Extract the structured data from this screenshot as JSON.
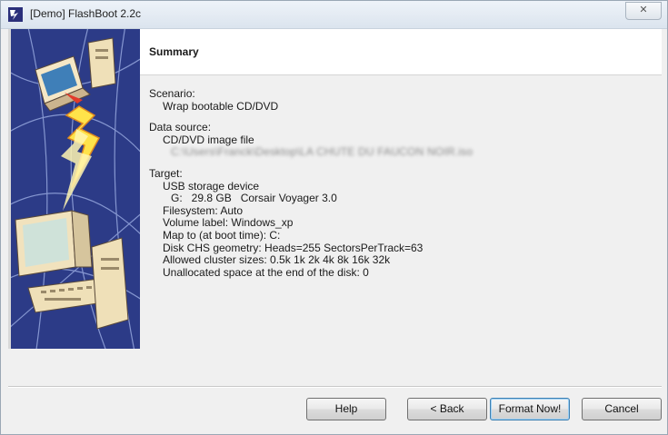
{
  "window": {
    "title": "[Demo] FlashBoot 2.2c",
    "close_glyph": "✕"
  },
  "header": {
    "title": "Summary"
  },
  "summary": {
    "scenario_label": "Scenario:",
    "scenario_value": "Wrap bootable CD/DVD",
    "data_source_label": "Data source:",
    "data_source_value": "CD/DVD image file",
    "data_source_path": "C:\\Users\\Franck\\Desktop\\LA CHUTE DU FAUCON NOIR.iso",
    "target_label": "Target:",
    "target_device": "USB storage device",
    "target_drive": "G:   29.8 GB   Corsair Voyager 3.0",
    "filesystem": "Filesystem: Auto",
    "volume_label": "Volume label: Windows_xp",
    "map_to": "Map to (at boot time): C:",
    "chs_geometry": "Disk CHS geometry: Heads=255 SectorsPerTrack=63",
    "cluster_sizes": "Allowed cluster sizes: 0.5k 1k 2k 4k 8k 16k 32k",
    "unallocated": "Unallocated space at the end of the disk: 0"
  },
  "buttons": {
    "help": "Help",
    "back": "< Back",
    "format_now": "Format Now!",
    "cancel": "Cancel"
  },
  "colors": {
    "banner_blue": "#2c3b87",
    "accent": "#3c7fb1"
  }
}
